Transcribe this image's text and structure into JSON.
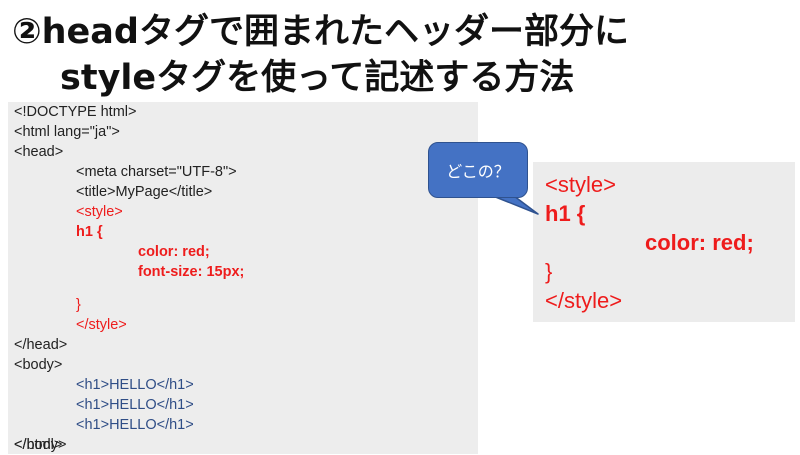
{
  "title": {
    "line1": "②headタグで囲まれたヘッダー部分に",
    "line2": "styleタグを使って記述する方法"
  },
  "code": {
    "lines": [
      "<!DOCTYPE html>",
      "<html lang=\"ja\">",
      "<head>",
      "<meta charset=\"UTF-8\">",
      "<title>MyPage</title>",
      "<style>",
      "h1 {",
      "color: red;",
      "font-size: 15px;",
      "}",
      "</style>",
      "</head>",
      "<body>",
      "<h1>HELLO</h1>",
      "<h1>HELLO</h1>",
      "<h1>HELLO</h1>",
      "</body>",
      "</html>"
    ]
  },
  "callout": {
    "text": "どこの？"
  },
  "snippet": {
    "lines": [
      "<style>",
      "h1 {",
      "color: red;",
      "}",
      "</style>"
    ]
  },
  "colors": {
    "code_red": "#ee1c1c",
    "code_blue": "#2f4d86",
    "callout_fill": "#4472c4",
    "panel_bg": "#ededed"
  }
}
